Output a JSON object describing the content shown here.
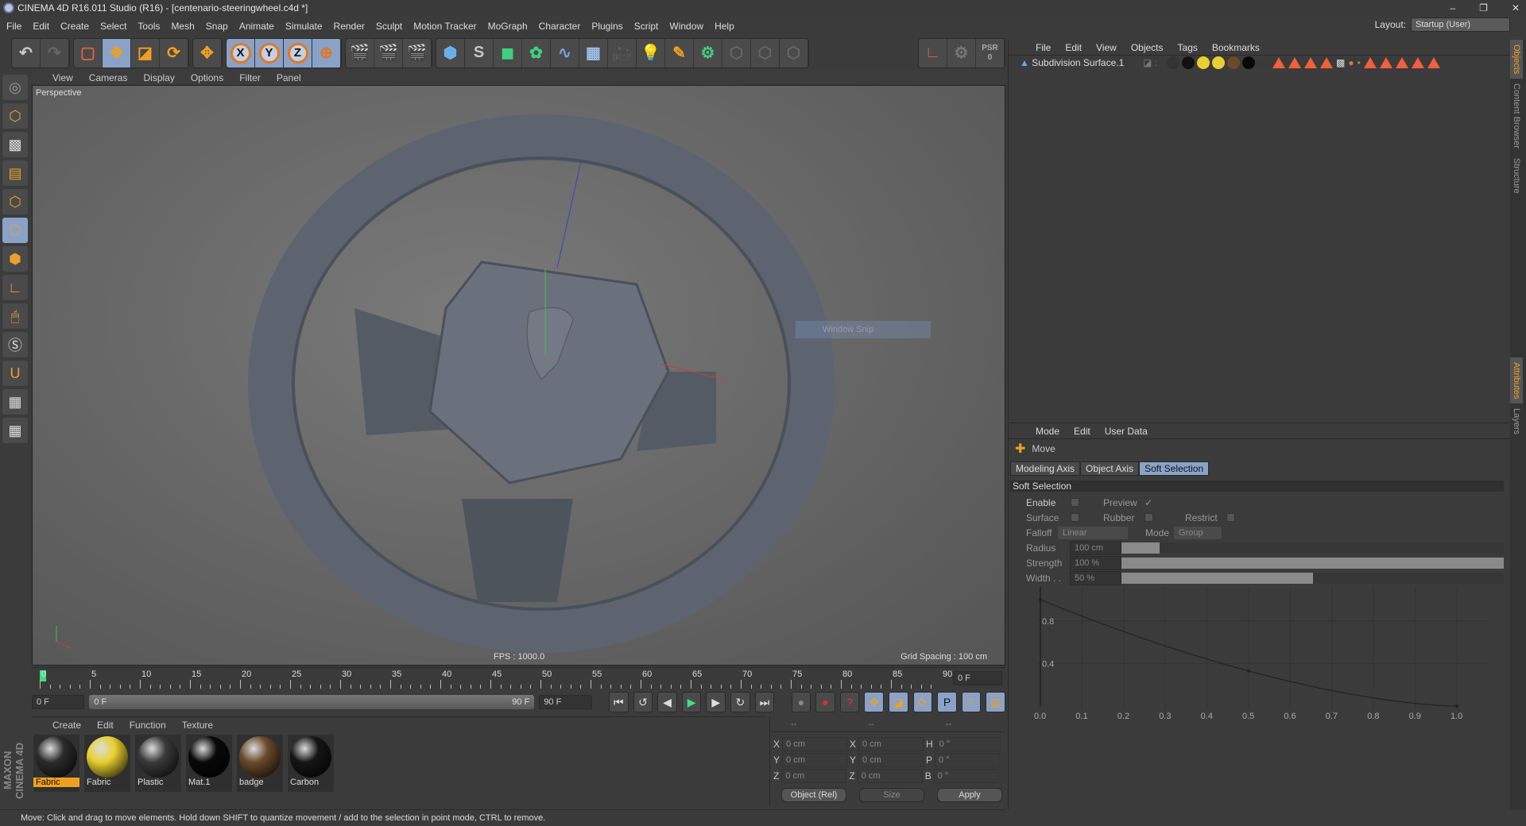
{
  "window": {
    "title": "CINEMA 4D R16.011 Studio (R16) - [centenario-steeringwheel.c4d *]",
    "controls": [
      "–",
      "❐",
      "✕"
    ]
  },
  "menu": [
    "File",
    "Edit",
    "Create",
    "Select",
    "Tools",
    "Mesh",
    "Snap",
    "Animate",
    "Simulate",
    "Render",
    "Sculpt",
    "Motion Tracker",
    "MoGraph",
    "Character",
    "Plugins",
    "Script",
    "Window",
    "Help"
  ],
  "layout": {
    "label": "Layout:",
    "value": "Startup (User)"
  },
  "toolbar": {
    "axis_x": "X",
    "axis_y": "Y",
    "axis_z": "Z",
    "psr": "PSR",
    "psr_value": "0"
  },
  "viewport": {
    "menu": [
      "View",
      "Cameras",
      "Display",
      "Options",
      "Filter",
      "Panel"
    ],
    "label": "Perspective",
    "fps": "FPS : 1000.0",
    "grid_spacing": "Grid Spacing : 100 cm",
    "overlay": "Window Snip",
    "model_color": "#5d6470"
  },
  "timeline": {
    "ticks": [
      "0",
      "5",
      "10",
      "15",
      "20",
      "25",
      "30",
      "35",
      "40",
      "45",
      "50",
      "55",
      "60",
      "65",
      "70",
      "75",
      "80",
      "85",
      "90"
    ],
    "current_frame": "0 F",
    "start": "0 F",
    "range_start": "0 F",
    "range_end": "90 F",
    "end": "90 F"
  },
  "materials": {
    "menu": [
      "Create",
      "Edit",
      "Function",
      "Texture"
    ],
    "items": [
      {
        "name": "Fabric",
        "color": "#2b2b2b",
        "selected": true
      },
      {
        "name": "Fabric",
        "color": "#e8d030"
      },
      {
        "name": "Plastic",
        "color": "#3a3a3a"
      },
      {
        "name": "Mat.1",
        "color": "#080808"
      },
      {
        "name": "badge",
        "color": "#6a4a2a"
      },
      {
        "name": "Carbon",
        "color": "#151515"
      }
    ]
  },
  "brand": "MAXON CINEMA 4D",
  "coordinates": {
    "headers": [
      "--",
      "--",
      "--"
    ],
    "rows": [
      {
        "a": "X",
        "av": "0 cm",
        "b": "X",
        "bv": "0 cm",
        "c": "H",
        "cv": "0 °"
      },
      {
        "a": "Y",
        "av": "0 cm",
        "b": "Y",
        "bv": "0 cm",
        "c": "P",
        "cv": "0 °"
      },
      {
        "a": "Z",
        "av": "0 cm",
        "b": "Z",
        "bv": "0 cm",
        "c": "B",
        "cv": "0 °"
      }
    ],
    "mode": "Object (Rel)",
    "size": "Size",
    "apply": "Apply"
  },
  "status": "Move: Click and drag to move elements. Hold down SHIFT to quantize movement / add to the selection in point mode, CTRL to remove.",
  "objects": {
    "menu": [
      "File",
      "Edit",
      "View",
      "Objects",
      "Tags",
      "Bookmarks"
    ],
    "items": [
      {
        "name": "Subdivision Surface.1"
      }
    ]
  },
  "side_tabs": [
    "Objects",
    "Content Browser",
    "Structure",
    "Attributes",
    "Layers"
  ],
  "attributes": {
    "menu": [
      "Mode",
      "Edit",
      "User Data"
    ],
    "tool": "Move",
    "tabs": [
      "Modeling Axis",
      "Object Axis",
      "Soft Selection"
    ],
    "active_tab": "Soft Selection",
    "section": "Soft Selection",
    "enable": {
      "label": "Enable",
      "checked": false
    },
    "preview": {
      "label": "Preview",
      "checked": true
    },
    "surface": {
      "label": "Surface",
      "checked": false
    },
    "rubber": {
      "label": "Rubber",
      "checked": false
    },
    "restrict": {
      "label": "Restrict",
      "checked": false
    },
    "falloff": {
      "label": "Falloff",
      "value": "Linear"
    },
    "mode": {
      "label": "Mode",
      "value": "Group"
    },
    "radius": {
      "label": "Radius",
      "value": "100 cm",
      "fill": 0.1
    },
    "strength": {
      "label": "Strength",
      "value": "100 %",
      "fill": 1.0
    },
    "width": {
      "label": "Width . .",
      "value": "50 %",
      "fill": 0.5
    },
    "graph": {
      "y_ticks": [
        "0.8",
        "0.4"
      ],
      "x_ticks": [
        "0.0",
        "0.1",
        "0.2",
        "0.3",
        "0.4",
        "0.5",
        "0.6",
        "0.7",
        "0.8",
        "0.9",
        "1.0"
      ]
    }
  },
  "colors": {
    "accent": "#f0a020",
    "selection": "#8aa2c8"
  }
}
